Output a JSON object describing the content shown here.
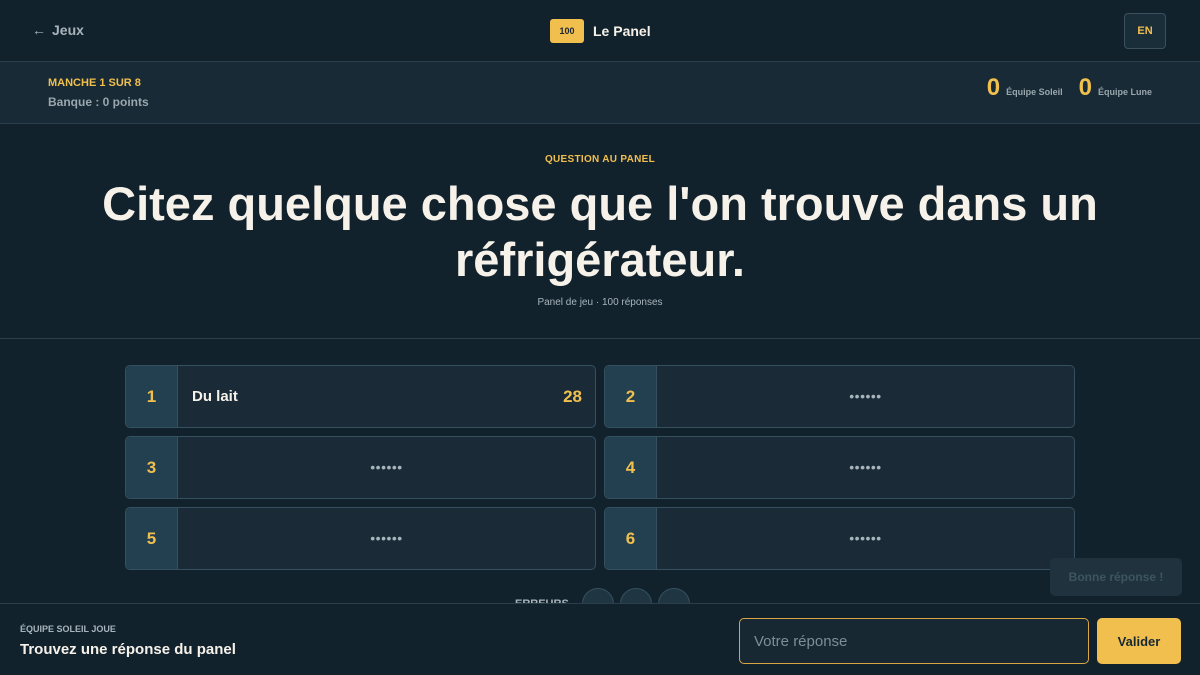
{
  "header": {
    "back_label": "Jeux",
    "brand_badge": "100",
    "brand_title": "Le Panel",
    "language_button": "EN"
  },
  "round": {
    "label": "MANCHE 1 SUR 8",
    "bank": "Banque : 0 points"
  },
  "teams": [
    {
      "score": "0",
      "name": "Équipe Soleil"
    },
    {
      "score": "0",
      "name": "Équipe Lune"
    }
  ],
  "question": {
    "kicker": "QUESTION AU PANEL",
    "text": "Citez quelque chose que l'on trouve dans un réfrigérateur.",
    "meta": "Panel de jeu · 100 réponses"
  },
  "answers": [
    {
      "number": "1",
      "answer": "Du lait",
      "points": "28",
      "revealed": true
    },
    {
      "number": "2",
      "hidden": "••••••",
      "revealed": false
    },
    {
      "number": "3",
      "hidden": "••••••",
      "revealed": false
    },
    {
      "number": "4",
      "hidden": "••••••",
      "revealed": false
    },
    {
      "number": "5",
      "hidden": "••••••",
      "revealed": false
    },
    {
      "number": "6",
      "hidden": "••••••",
      "revealed": false
    }
  ],
  "strikes": {
    "label": "ERREURS",
    "used": 0,
    "total": 3
  },
  "toast": "Bonne réponse !",
  "footer": {
    "turn_label": "ÉQUIPE SOLEIL JOUE",
    "prompt": "Trouvez une réponse du panel",
    "input_placeholder": "Votre réponse",
    "input_value": "",
    "submit_label": "Valider"
  }
}
